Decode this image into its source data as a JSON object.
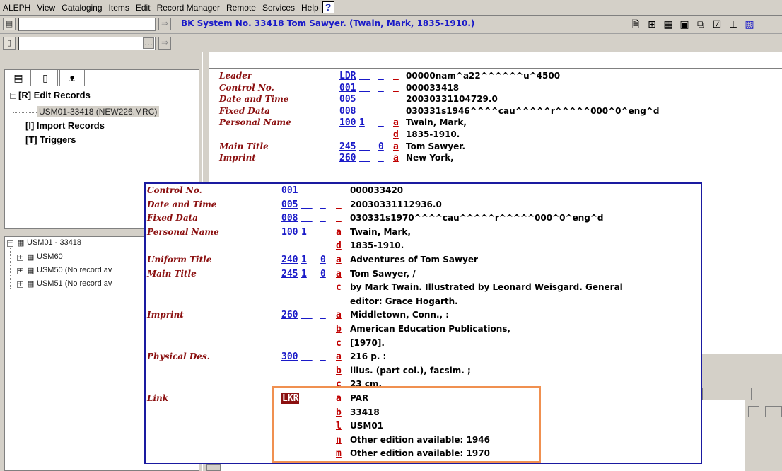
{
  "menu": [
    "ALEPH",
    "View",
    "Cataloging",
    "Items",
    "Edit",
    "Record Manager",
    "Remote",
    "Services",
    "Help"
  ],
  "help_glyph": "?",
  "toolbar": {
    "search_value": "",
    "search2_value": "",
    "record_title": "BK System No. 33418 Tom Sawyer. (Twain, Mark, 1835-1910.)"
  },
  "tree_top": {
    "tabs": [
      "tree-icon",
      "page-icon",
      "binoculars-icon"
    ],
    "items": [
      {
        "label": "[R] Edit Records"
      },
      {
        "label": "USM01-33418 (NEW226.MRC)"
      },
      {
        "label": "[I] Import Records"
      },
      {
        "label": "[T] Triggers"
      }
    ]
  },
  "tree_bottom": {
    "root": "USM01 - 33418",
    "children": [
      "USM60",
      "USM50 (No record av",
      "USM51 (No record av"
    ]
  },
  "background_record": {
    "rows": [
      {
        "label": "Leader",
        "tag": "LDR",
        "i1": "",
        "i2": "",
        "sub": "",
        "value": "00000nam^a22^^^^^^u^4500"
      },
      {
        "label": "Control No.",
        "tag": "001",
        "i1": "",
        "i2": "",
        "sub": "",
        "value": "000033418"
      },
      {
        "label": "Date and Time",
        "tag": "005",
        "i1": "",
        "i2": "",
        "sub": "",
        "value": "20030331104729.0"
      },
      {
        "label": "Fixed Data",
        "tag": "008",
        "i1": "",
        "i2": "",
        "sub": "",
        "value": "030331s1946^^^^cau^^^^^r^^^^^000^0^eng^d"
      },
      {
        "label": "Personal Name",
        "tag": "100",
        "i1": "1",
        "i2": "",
        "sub": "a",
        "value": "Twain, Mark,"
      },
      {
        "label": "",
        "tag": "",
        "i1": "",
        "i2": "",
        "sub": "d",
        "value": "1835-1910."
      },
      {
        "label": "Main Title",
        "tag": "245",
        "i1": "",
        "i2": "0",
        "sub": "a",
        "value": "Tom Sawyer."
      },
      {
        "label": "Imprint",
        "tag": "260",
        "i1": "",
        "i2": "",
        "sub": "a",
        "value": "New York,"
      }
    ]
  },
  "popup_record": {
    "rows": [
      {
        "label": "Control No.",
        "tag": "001",
        "i1": "",
        "i2": "",
        "sub": "",
        "value": "000033420"
      },
      {
        "label": "Date and Time",
        "tag": "005",
        "i1": "",
        "i2": "",
        "sub": "",
        "value": "20030331112936.0"
      },
      {
        "label": "Fixed Data",
        "tag": "008",
        "i1": "",
        "i2": "",
        "sub": "",
        "value": "030331s1970^^^^cau^^^^^r^^^^^000^0^eng^d"
      },
      {
        "label": "Personal Name",
        "tag": "100",
        "i1": "1",
        "i2": "",
        "sub": "a",
        "value": "Twain, Mark,"
      },
      {
        "label": "",
        "tag": "",
        "i1": "",
        "i2": "",
        "sub": "d",
        "value": "1835-1910."
      },
      {
        "label": "Uniform Title",
        "tag": "240",
        "i1": "1",
        "i2": "0",
        "sub": "a",
        "value": "Adventures of Tom Sawyer"
      },
      {
        "label": "Main Title",
        "tag": "245",
        "i1": "1",
        "i2": "0",
        "sub": "a",
        "value": "Tom Sawyer, /"
      },
      {
        "label": "",
        "tag": "",
        "i1": "",
        "i2": "",
        "sub": "c",
        "value": "by Mark Twain. Illustrated by Leonard Weisgard. General"
      },
      {
        "label": "",
        "tag": "",
        "i1": "",
        "i2": "",
        "sub": "",
        "value": "editor: Grace Hogarth."
      },
      {
        "label": "Imprint",
        "tag": "260",
        "i1": "",
        "i2": "",
        "sub": "a",
        "value": "Middletown, Conn., :"
      },
      {
        "label": "",
        "tag": "",
        "i1": "",
        "i2": "",
        "sub": "b",
        "value": "American Education Publications,"
      },
      {
        "label": "",
        "tag": "",
        "i1": "",
        "i2": "",
        "sub": "c",
        "value": "[1970]."
      },
      {
        "label": "Physical Des.",
        "tag": "300",
        "i1": "",
        "i2": "",
        "sub": "a",
        "value": "216 p. :"
      },
      {
        "label": "",
        "tag": "",
        "i1": "",
        "i2": "",
        "sub": "b",
        "value": "illus. (part col.), facsim. ;"
      },
      {
        "label": "",
        "tag": "",
        "i1": "",
        "i2": "",
        "sub": "c",
        "value": "23 cm."
      },
      {
        "label": "Link",
        "tag": "LKR",
        "i1": "",
        "i2": "",
        "sub": "a",
        "value": "PAR"
      },
      {
        "label": "",
        "tag": "",
        "i1": "",
        "i2": "",
        "sub": "b",
        "value": "33418"
      },
      {
        "label": "",
        "tag": "",
        "i1": "",
        "i2": "",
        "sub": "l",
        "value": "USM01"
      },
      {
        "label": "",
        "tag": "",
        "i1": "",
        "i2": "",
        "sub": "n",
        "value": "Other edition available: 1946"
      },
      {
        "label": "",
        "tag": "",
        "i1": "",
        "i2": "",
        "sub": "m",
        "value": "Other edition available: 1970"
      }
    ]
  },
  "colors": {
    "tag_blue": "#1a1ac8",
    "label_red": "#8b1010",
    "subfield_red": "#c00000",
    "popup_border": "#1a1aa0",
    "highlight_orange": "#f09050"
  }
}
